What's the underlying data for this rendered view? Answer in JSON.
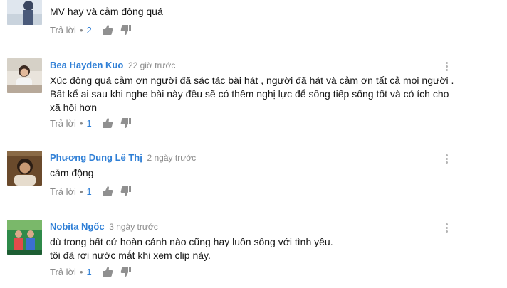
{
  "comments": [
    {
      "author": "",
      "time": "",
      "text": "MV hay và cảm động quá",
      "reply_label": "Trả lời",
      "separator": "•",
      "likes": "2"
    },
    {
      "author": "Bea Hayden Kuo",
      "time": "22 giờ trước",
      "text": "Xúc động quá cảm ơn người đã sác tác bài hát , người đã hát và cảm ơn tất cả mọi người .\nBất kể ai sau khi nghe bài này đều sẽ có thêm nghị lực để sống tiếp sống tốt và có ích cho\nxã hội hơn",
      "reply_label": "Trả lời",
      "separator": "•",
      "likes": "1"
    },
    {
      "author": "Phương Dung Lê Thị",
      "time": "2 ngày trước",
      "text": "cảm động",
      "reply_label": "Trả lời",
      "separator": "•",
      "likes": "1"
    },
    {
      "author": "Nobita Ngốc",
      "time": "3 ngày trước",
      "text": "dù trong bất cứ hoàn cảnh nào cũng hay luôn sống với tình yêu.\ntôi đã rơi nước mắt khi xem clip này.",
      "reply_label": "Trả lời",
      "separator": "•",
      "likes": "1"
    }
  ],
  "icons": {
    "like": "thumb-up-icon",
    "dislike": "thumb-down-icon",
    "menu": "more-vert-icon"
  },
  "colors": {
    "author": "#2f7fd6",
    "meta": "#8a8a8a",
    "icon": "#909090"
  }
}
